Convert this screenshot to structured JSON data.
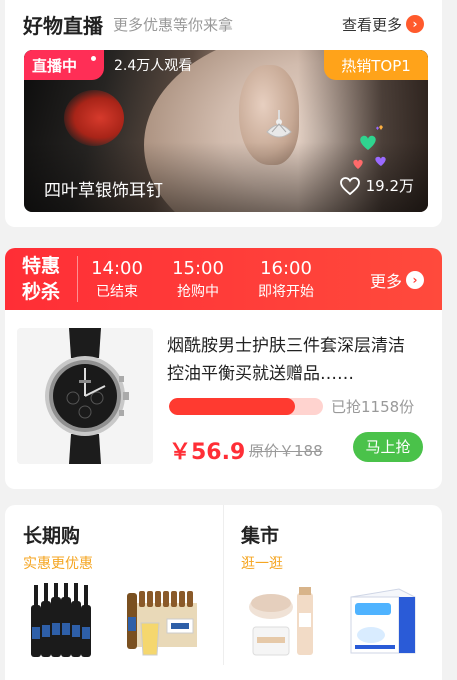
{
  "live": {
    "title": "好物直播",
    "subtitle": "更多优惠等你来拿",
    "see_more": "查看更多",
    "badge": "直播中",
    "viewers": "2.4万人观看",
    "hot_badge": "热销TOP1",
    "product_name": "四叶草银饰耳钉",
    "likes": "19.2万"
  },
  "flash": {
    "title_line1": "特惠",
    "title_line2": "秒杀",
    "slots": [
      {
        "time": "14:00",
        "status": "已结束"
      },
      {
        "time": "15:00",
        "status": "抢购中"
      },
      {
        "time": "16:00",
        "status": "即将开始"
      }
    ],
    "more": "更多",
    "product_title": "烟酰胺男士护肤三件套深层清洁控油平衡买就送赠品……",
    "progress_fraction": 0.82,
    "grabbed": "已抢1158份",
    "price": "￥56.9",
    "original_price": "原价￥188",
    "buy_label": "马上抢"
  },
  "categories": [
    {
      "title": "长期购",
      "subtitle": "实惠更优惠"
    },
    {
      "title": "集市",
      "subtitle": "逛一逛"
    }
  ],
  "colors": {
    "accent_red": "#ff2e36",
    "live_badge": "#ff2e56",
    "hot_badge": "#ffa31a",
    "buy_button": "#4ac24a",
    "subtitle_orange": "#f5a623"
  }
}
